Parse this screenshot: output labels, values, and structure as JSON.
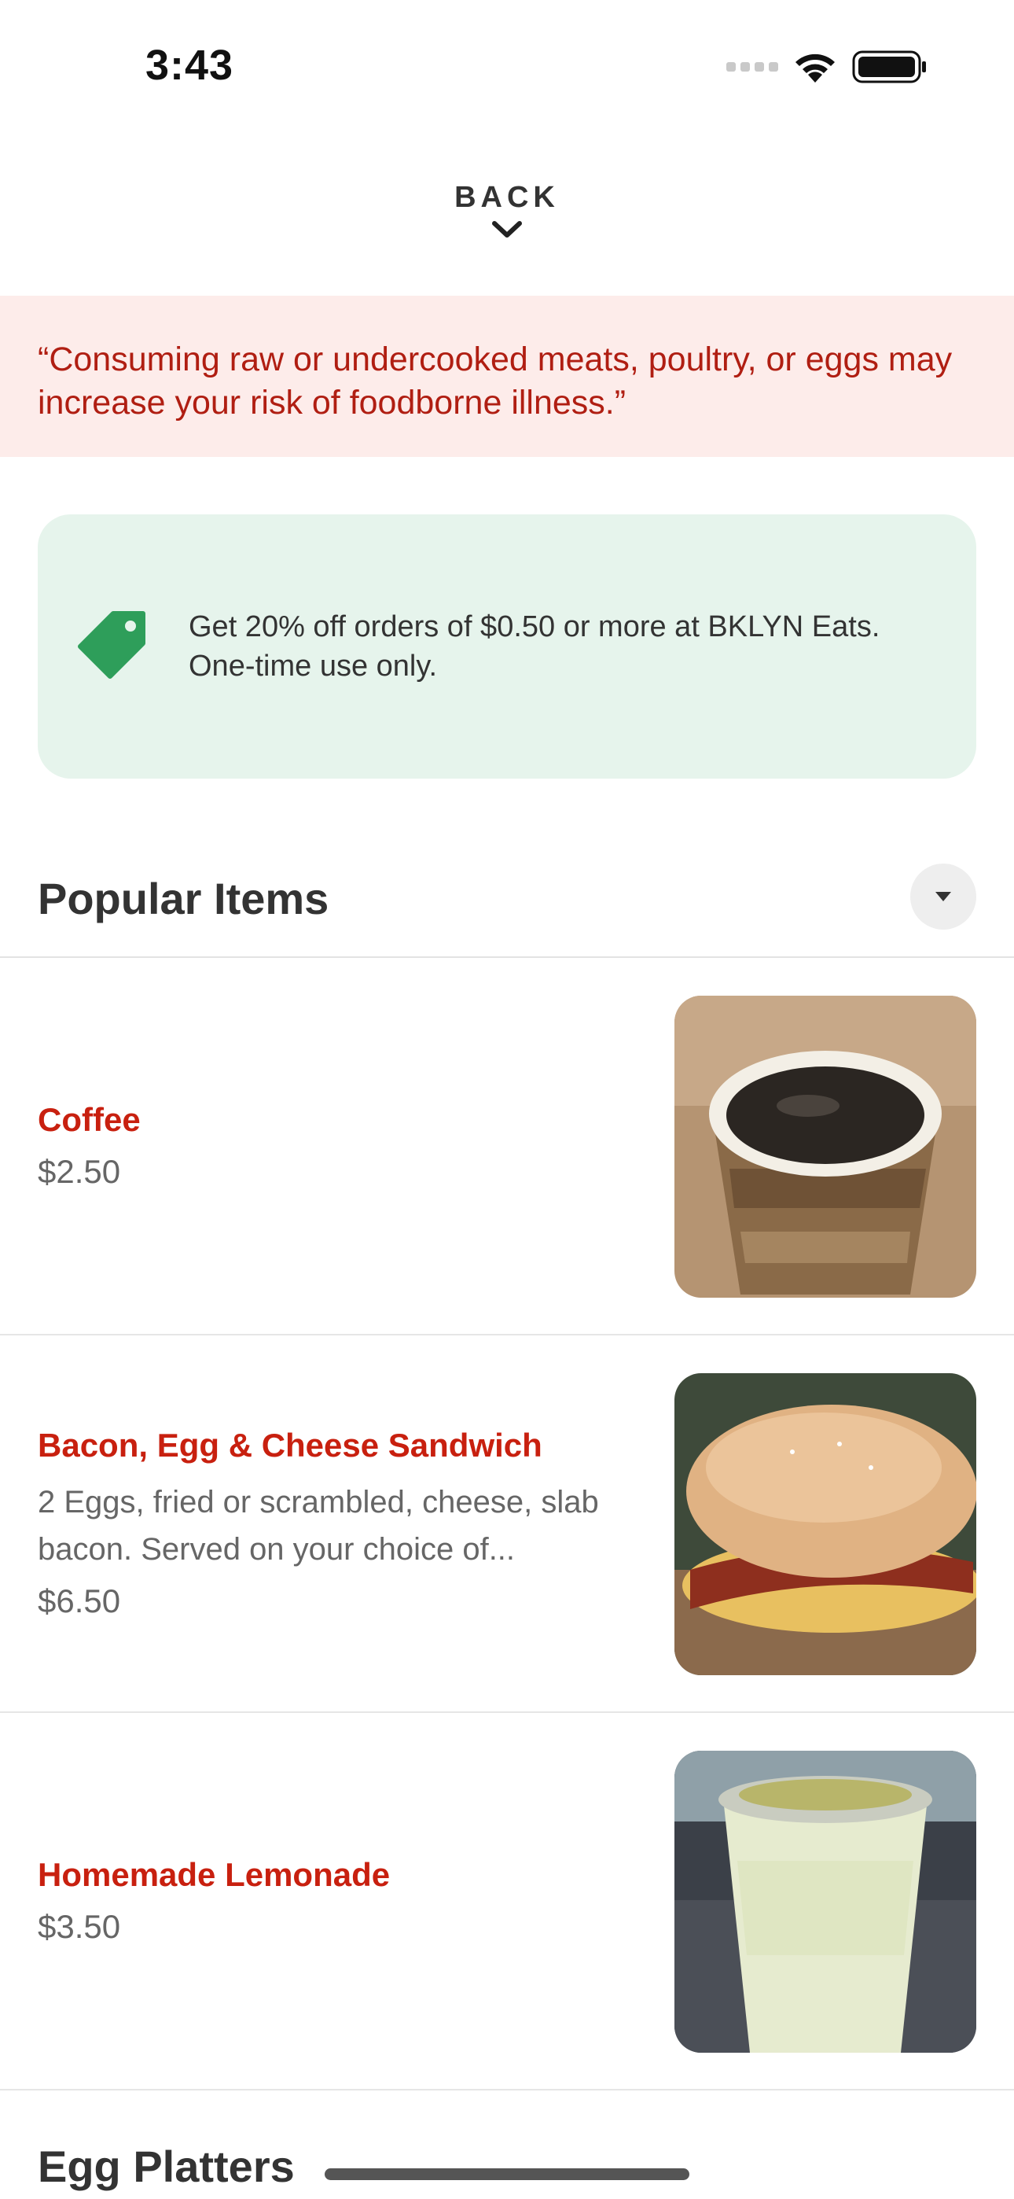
{
  "status_bar": {
    "time": "3:43"
  },
  "nav": {
    "back_label": "BACK"
  },
  "notice": {
    "text": "“Consuming raw or undercooked meats, poultry, or eggs may increase your risk of foodborne illness.”"
  },
  "promo": {
    "text": "Get 20% off orders of $0.50 or more at BKLYN Eats. One-time use only."
  },
  "sections": [
    {
      "title": "Popular Items",
      "items": [
        {
          "name": "Coffee",
          "description": "",
          "price": "$2.50",
          "photo": "coffee-cup"
        },
        {
          "name": "Bacon, Egg & Cheese Sandwich",
          "description": "2 Eggs, fried or scrambled, cheese, slab bacon. Served on your choice of...",
          "price": "$6.50",
          "photo": "bagel-sandwich"
        },
        {
          "name": "Homemade Lemonade",
          "description": "",
          "price": "$3.50",
          "photo": "lemonade-cup"
        }
      ]
    },
    {
      "title": "Egg Platters"
    }
  ],
  "colors": {
    "accent_red": "#c8200f",
    "promo_green": "#2e9e5a",
    "notice_bg": "#fdecea",
    "promo_bg": "#e6f4ec"
  }
}
